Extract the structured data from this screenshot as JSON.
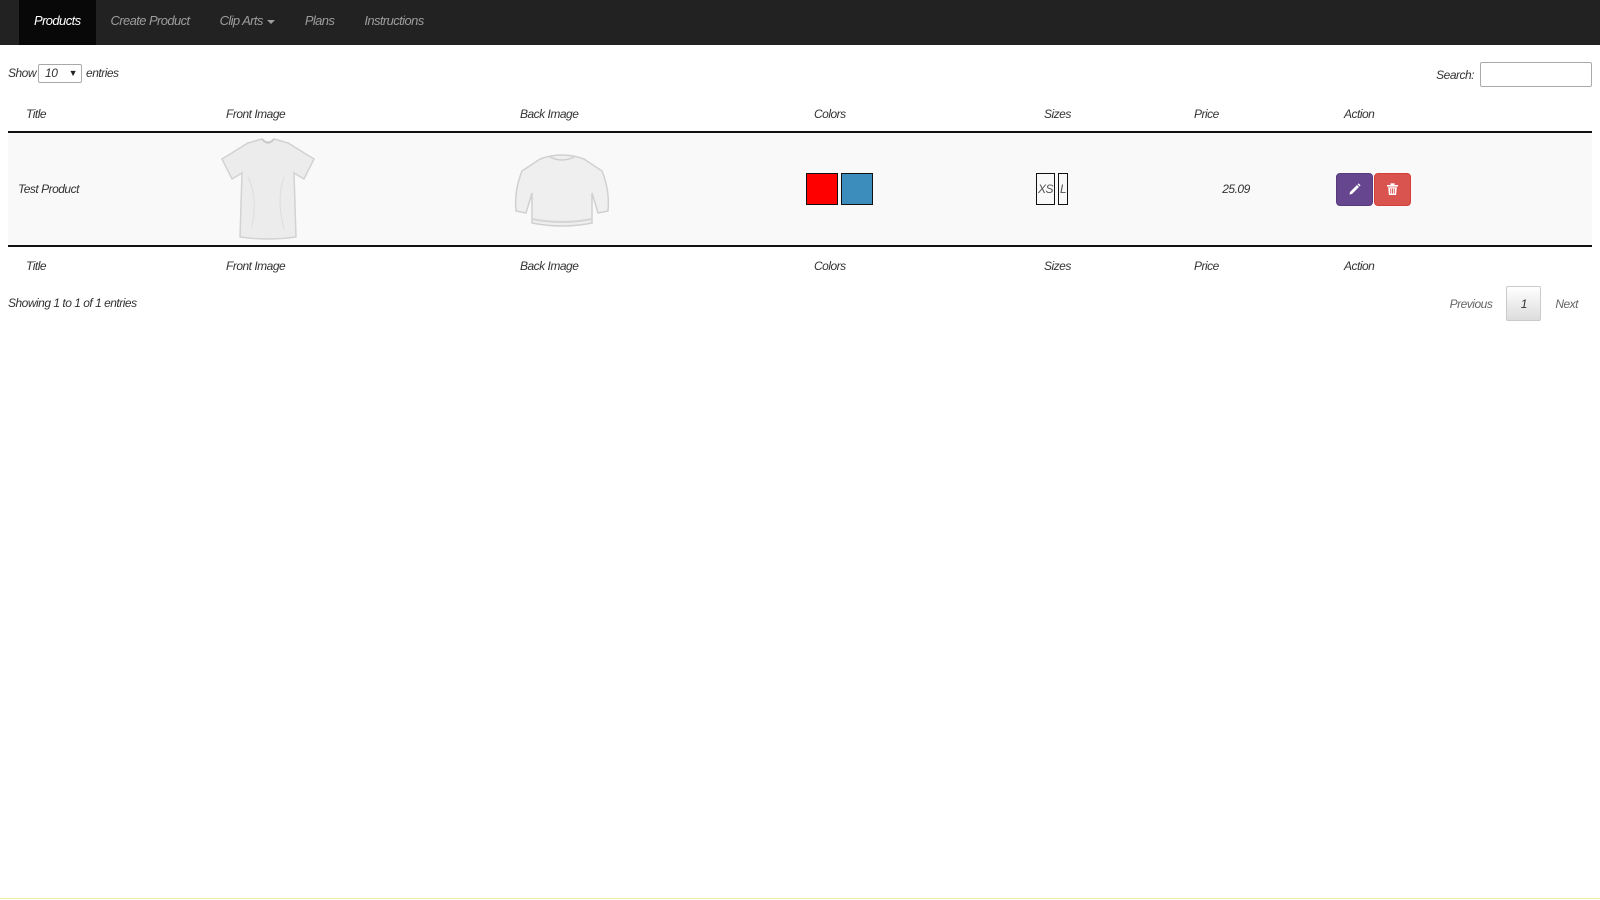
{
  "nav": {
    "items": [
      {
        "label": "Products",
        "active": true
      },
      {
        "label": "Create Product",
        "active": false
      },
      {
        "label": "Clip Arts",
        "active": false,
        "dropdown": true
      },
      {
        "label": "Plans",
        "active": false
      },
      {
        "label": "Instructions",
        "active": false
      }
    ]
  },
  "length": {
    "show_label": "Show",
    "value": "10",
    "entries_label": "entries"
  },
  "search": {
    "label": "Search:",
    "value": ""
  },
  "table": {
    "headers": [
      "Title",
      "Front Image",
      "Back Image",
      "Colors",
      "Sizes",
      "Price",
      "Action"
    ],
    "rows": [
      {
        "title": "Test Product",
        "colors": [
          "#ff0000",
          "#3c8dbc"
        ],
        "sizes": [
          "XS",
          "L"
        ],
        "price": "25.09"
      }
    ]
  },
  "info": "Showing 1 to 1 of 1 entries",
  "pagination": {
    "previous": "Previous",
    "page": "1",
    "next": "Next"
  },
  "icons": {
    "edit": "pencil-icon",
    "delete": "trash-icon"
  }
}
